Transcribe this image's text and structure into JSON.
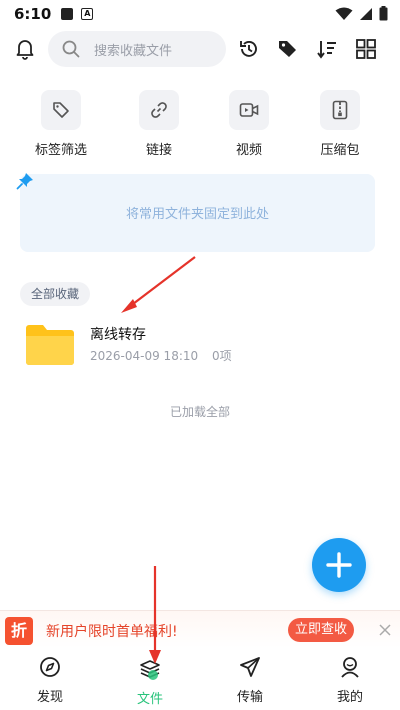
{
  "status_bar": {
    "time": "6:10",
    "a_glyph": "A"
  },
  "top_bar": {
    "search_placeholder": "搜索收藏文件",
    "icons": [
      "bell-icon",
      "history-icon",
      "tag-icon",
      "sort-icon",
      "grid-view-icon"
    ]
  },
  "categories": [
    {
      "label": "标签筛选",
      "icon": "tag-icon"
    },
    {
      "label": "链接",
      "icon": "link-icon"
    },
    {
      "label": "视频",
      "icon": "video-icon"
    },
    {
      "label": "压缩包",
      "icon": "zip-icon"
    }
  ],
  "pinned": {
    "text": "将常用文件夹固定到此处"
  },
  "section": {
    "chip": "全部收藏"
  },
  "folder": {
    "name": "离线转存",
    "date": "2026-04-09 18:10",
    "count": "0项"
  },
  "loaded_text": "已加载全部",
  "promo": {
    "badge": "折",
    "text": "新用户限时首单福利!",
    "button": "立即查收"
  },
  "tabs": [
    {
      "label": "发现",
      "icon": "compass-icon",
      "active": false
    },
    {
      "label": "文件",
      "icon": "files-stack-icon",
      "active": true
    },
    {
      "label": "传输",
      "icon": "send-icon",
      "active": false
    },
    {
      "label": "我的",
      "icon": "profile-icon",
      "active": false
    }
  ],
  "colors": {
    "accent_blue": "#1e9cf0",
    "active_tab": "#28c37b",
    "promo_red": "#f35a43",
    "folder_yellow": "#ffcb2f",
    "annotation_red": "#e5332a"
  }
}
